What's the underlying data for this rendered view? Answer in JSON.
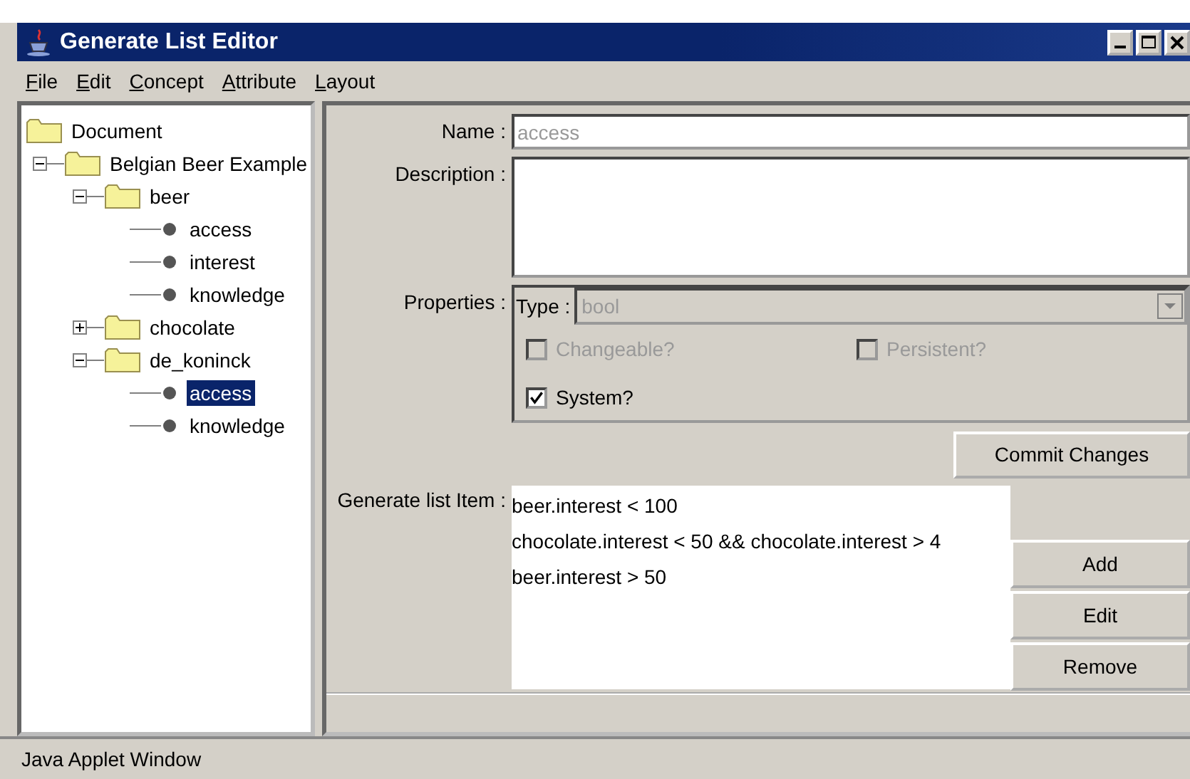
{
  "window": {
    "title": "Generate List Editor"
  },
  "menu": [
    {
      "label": "File"
    },
    {
      "label": "Edit"
    },
    {
      "label": "Concept"
    },
    {
      "label": "Attribute"
    },
    {
      "label": "Layout"
    }
  ],
  "tree": [
    {
      "label": "Document",
      "kind": "folder",
      "selected": false,
      "children": [
        {
          "label": "Belgian Beer Example",
          "kind": "folder",
          "expanded": true,
          "selected": false,
          "children": [
            {
              "label": "beer",
              "kind": "folder",
              "expanded": true,
              "selected": false,
              "children": [
                {
                  "label": "access",
                  "kind": "leaf",
                  "selected": false
                },
                {
                  "label": "interest",
                  "kind": "leaf",
                  "selected": false
                },
                {
                  "label": "knowledge",
                  "kind": "leaf",
                  "selected": false
                }
              ]
            },
            {
              "label": "chocolate",
              "kind": "folder",
              "expanded": false,
              "selected": false
            },
            {
              "label": "de_koninck",
              "kind": "folder",
              "expanded": true,
              "selected": false,
              "children": [
                {
                  "label": "access",
                  "kind": "leaf",
                  "selected": true
                },
                {
                  "label": "knowledge",
                  "kind": "leaf",
                  "selected": false
                }
              ]
            }
          ]
        }
      ]
    }
  ],
  "form": {
    "name": {
      "label": "Name :",
      "value": "access",
      "disabled": true
    },
    "description": {
      "label": "Description :"
    },
    "properties": {
      "label": "Properties :",
      "type_label": "Type :",
      "type_value": "bool",
      "disabled": true,
      "checkboxes": [
        {
          "label": "Changeable?",
          "checked": false,
          "disabled": true
        },
        {
          "label": "Persistent?",
          "checked": false,
          "disabled": true
        },
        {
          "label": "System?",
          "checked": true,
          "disabled": false
        }
      ]
    },
    "commit_button": "Commit Changes",
    "generate_list": {
      "label": "Generate list Item :",
      "items": [
        {
          "text": "beer.interest < 100"
        },
        {
          "text": "chocolate.interest < 50 && chocolate.interest > 4"
        },
        {
          "text": "beer.interest > 50"
        }
      ],
      "buttons": [
        "Add",
        "Edit",
        "Remove"
      ]
    }
  },
  "status_bar": "Java Applet Window"
}
